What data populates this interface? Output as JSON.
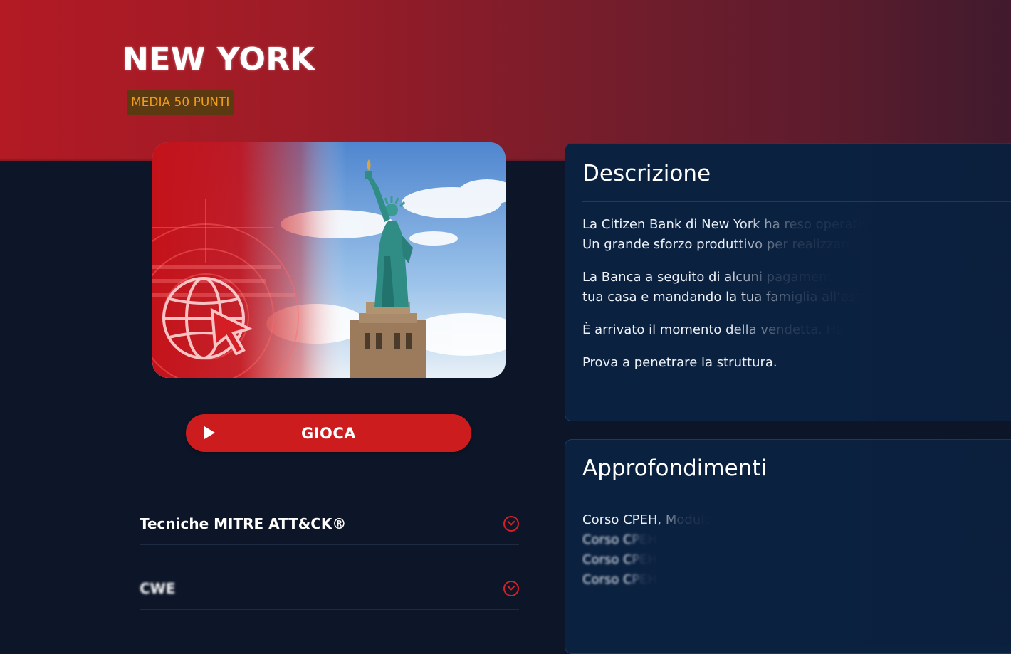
{
  "header": {
    "title": "NEW YORK",
    "badge": "MEDIA 50 PUNTI"
  },
  "hero_image": {
    "subject": "statue-of-liberty",
    "overlay_icon": "globe-cursor-icon"
  },
  "play_button": {
    "label": "GIOCA",
    "icon": "play-icon"
  },
  "accordion": [
    {
      "label": "Tecniche MITRE ATT&CK®",
      "icon": "chevron-down-circle-icon"
    },
    {
      "label": "CWE",
      "icon": "chevron-down-circle-icon"
    }
  ],
  "description": {
    "title": "Descrizione",
    "paragraphs": [
      [
        "La Citizen Bank di New York ha reso operativ",
        "Un grande sforzo produttivo per realizzare"
      ],
      [
        "La Banca a seguito di alcuni pagamenti",
        "tua casa e mandando la tua famiglia all’astr"
      ],
      [
        "È arrivato il momento della vendetta. Hai"
      ],
      [
        "Prova a penetrare la struttura."
      ]
    ]
  },
  "resources": {
    "title": "Approfondimenti",
    "items": [
      "Corso CPEH,  Modulo",
      "Corso CPEH,",
      "Corso CPEH,",
      "Corso CPEH,"
    ]
  },
  "colors": {
    "header_red": "#b31a24",
    "background": "#0d1628",
    "panel": "#0b2140",
    "button_red": "#cc1c1e",
    "badge_bg": "#5b3a12",
    "badge_text": "#ef9d1c"
  }
}
